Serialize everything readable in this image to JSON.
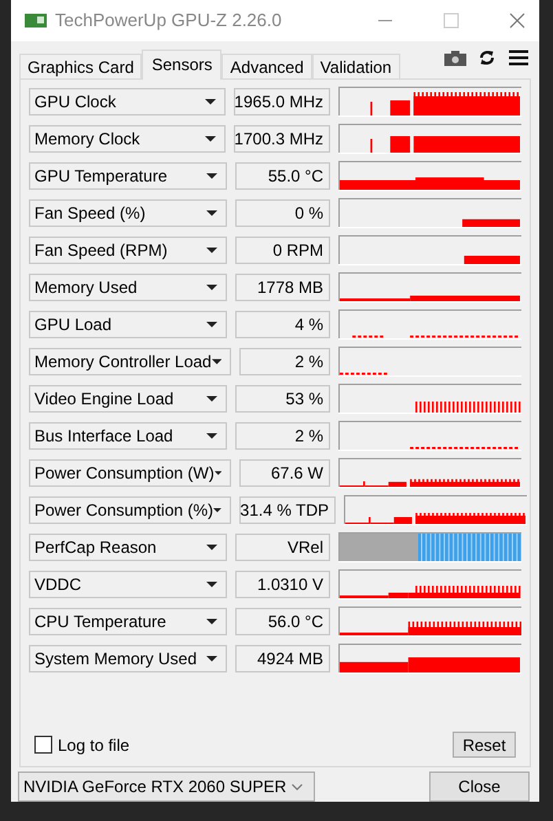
{
  "window": {
    "title": "TechPowerUp GPU-Z 2.26.0"
  },
  "tabs": [
    {
      "label": "Graphics Card",
      "selected": false
    },
    {
      "label": "Sensors",
      "selected": true
    },
    {
      "label": "Advanced",
      "selected": false
    },
    {
      "label": "Validation",
      "selected": false
    }
  ],
  "sensors": [
    {
      "name": "GPU Clock",
      "value": "1965.0 MHz"
    },
    {
      "name": "Memory Clock",
      "value": "1700.3 MHz"
    },
    {
      "name": "GPU Temperature",
      "value": "55.0 °C"
    },
    {
      "name": "Fan Speed (%)",
      "value": "0 %"
    },
    {
      "name": "Fan Speed (RPM)",
      "value": "0 RPM"
    },
    {
      "name": "Memory Used",
      "value": "1778 MB"
    },
    {
      "name": "GPU Load",
      "value": "4 %"
    },
    {
      "name": "Memory Controller Load",
      "value": "2 %"
    },
    {
      "name": "Video Engine Load",
      "value": "53 %"
    },
    {
      "name": "Bus Interface Load",
      "value": "2 %"
    },
    {
      "name": "Power Consumption (W)",
      "value": "67.6 W"
    },
    {
      "name": "Power Consumption (%)",
      "value": "31.4 % TDP"
    },
    {
      "name": "PerfCap Reason",
      "value": "VRel"
    },
    {
      "name": "VDDC",
      "value": "1.0310 V"
    },
    {
      "name": "CPU Temperature",
      "value": "56.0 °C"
    },
    {
      "name": "System Memory Used",
      "value": "4924 MB"
    }
  ],
  "log_to_file": {
    "label": "Log to file",
    "checked": false
  },
  "reset_button": "Reset",
  "gpu_select": {
    "value": "NVIDIA GeForce RTX 2060 SUPER"
  },
  "close_button": "Close"
}
